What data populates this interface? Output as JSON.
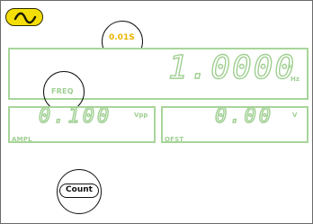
{
  "waveform": {
    "icon": "sine-wave-icon",
    "color": "#f4de08"
  },
  "sweep": {
    "speed": "0.01S"
  },
  "frequency": {
    "label": "FREQ",
    "value": "1.0000",
    "unit_prefix": "k",
    "unit": "Hz"
  },
  "amplitude": {
    "label": "AMPL",
    "value": "0.100",
    "unit": "Vpp"
  },
  "offset": {
    "label": "OFST",
    "value": "0.00",
    "unit": "V"
  },
  "softkeys": {
    "count_label": "Count"
  },
  "colors": {
    "segment": "#9fcf91",
    "accent": "#e9b400"
  }
}
